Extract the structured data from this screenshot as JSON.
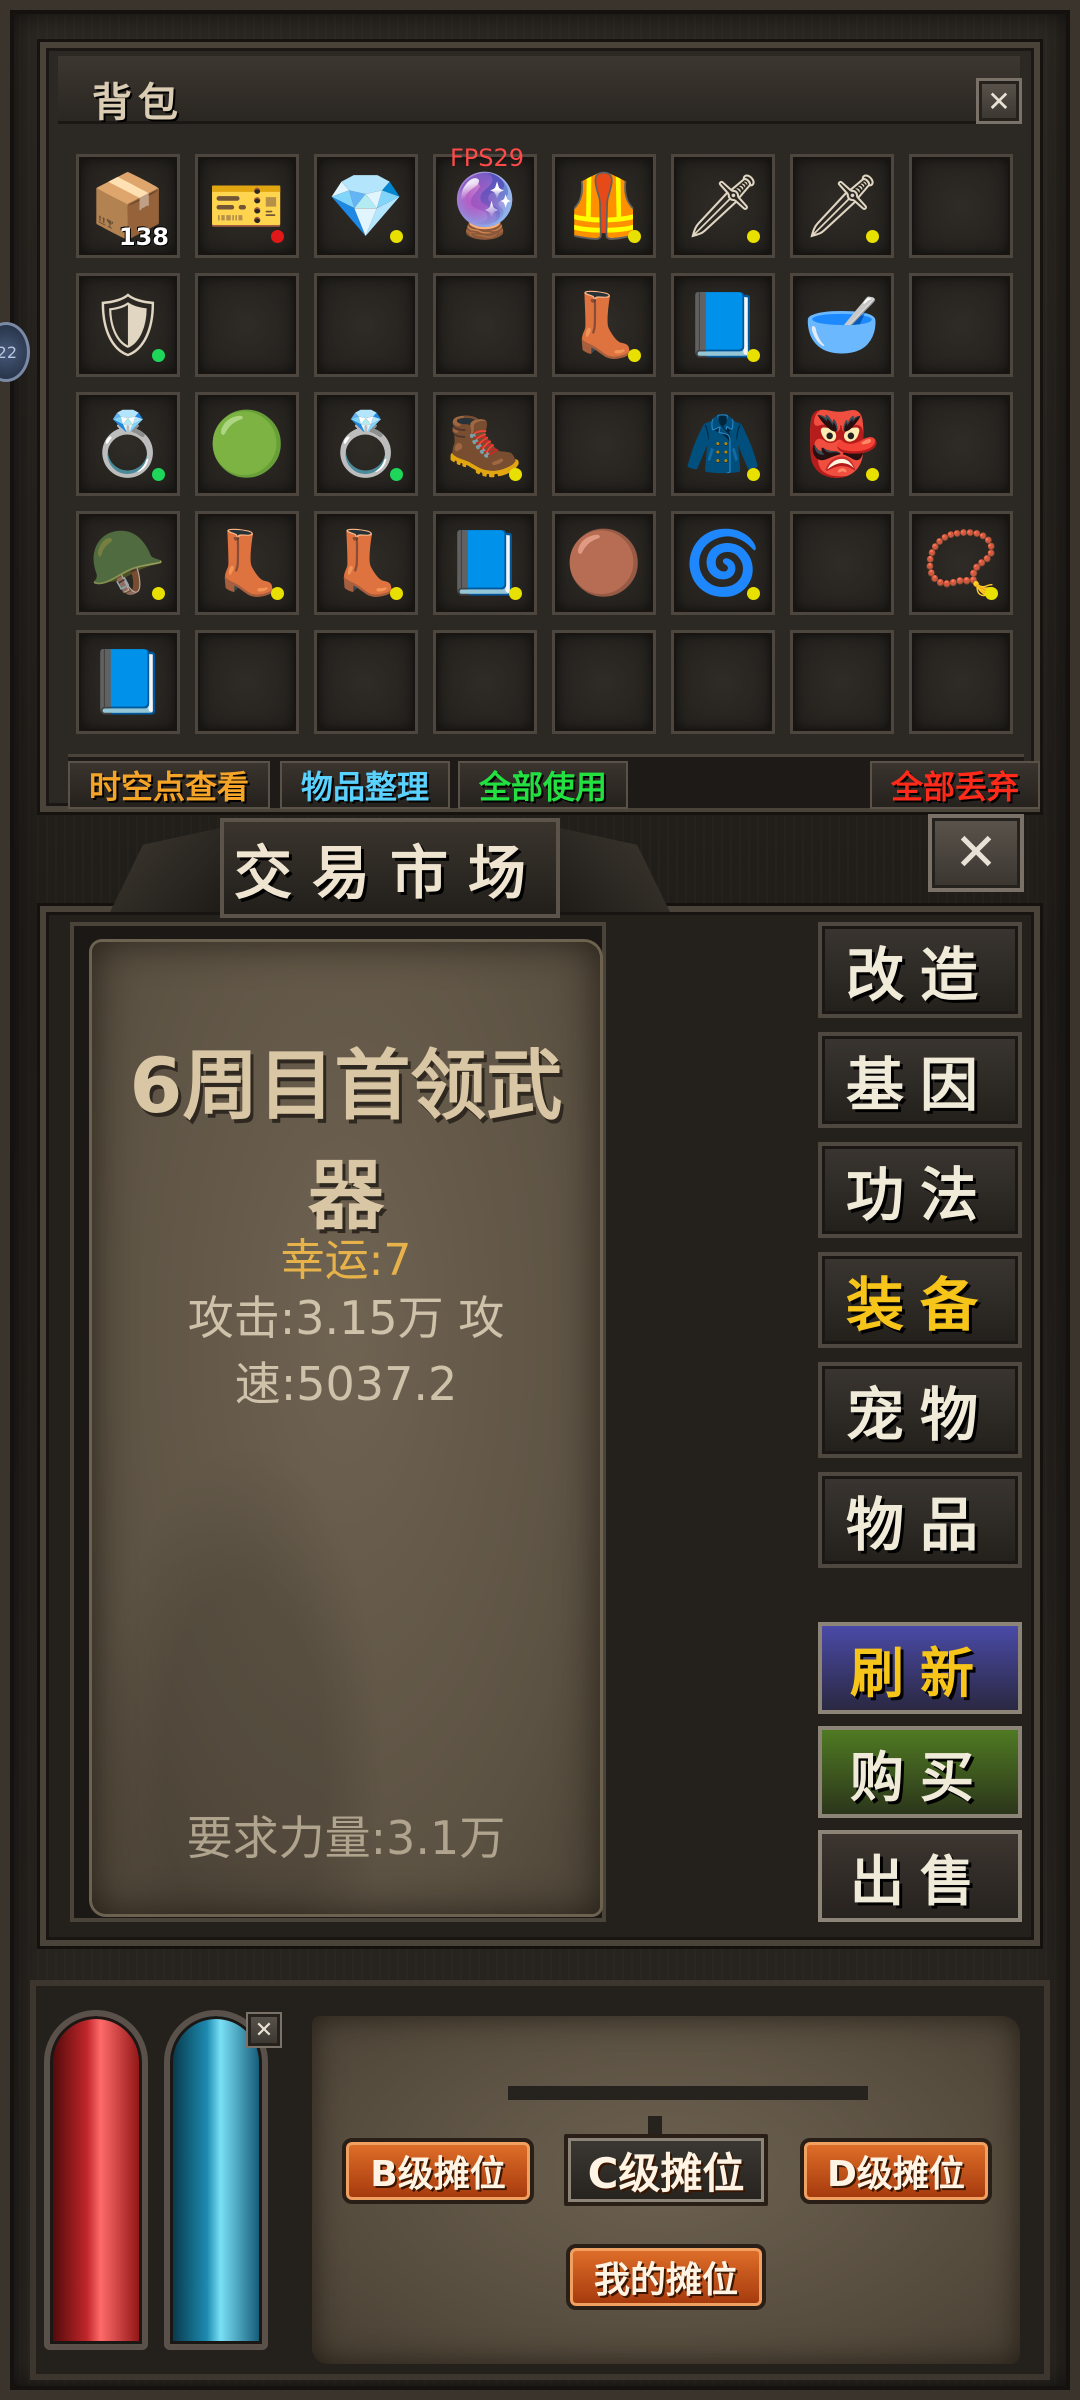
{
  "fps": "FPS29",
  "edge_badge": "22",
  "bag": {
    "title": "背包",
    "close": "✕",
    "slots": [
      {
        "icon": "📦",
        "name": "item-bundle-icon",
        "dot": "",
        "count": "138"
      },
      {
        "icon": "🎫",
        "name": "purple-scroll-icon",
        "dot": "red"
      },
      {
        "icon": "💎",
        "name": "blue-crystal-icon",
        "dot": "yellow"
      },
      {
        "icon": "🔮",
        "name": "green-orb-icon",
        "dot": ""
      },
      {
        "icon": "🦺",
        "name": "white-armor-icon",
        "dot": "yellow"
      },
      {
        "icon": "🗡",
        "name": "claw-weapon-icon",
        "dot": "yellow"
      },
      {
        "icon": "🗡",
        "name": "claw-weapon-icon",
        "dot": "yellow"
      },
      {
        "icon": "",
        "name": "empty-slot",
        "dot": ""
      },
      {
        "icon": "🛡",
        "name": "dark-helmet-icon",
        "dot": "green"
      },
      {
        "icon": "",
        "name": "empty-slot",
        "dot": ""
      },
      {
        "icon": "",
        "name": "empty-slot",
        "dot": ""
      },
      {
        "icon": "",
        "name": "empty-slot",
        "dot": ""
      },
      {
        "icon": "👢",
        "name": "red-boots-icon",
        "dot": "yellow"
      },
      {
        "icon": "📘",
        "name": "skill-book-icon",
        "dot": "yellow"
      },
      {
        "icon": "🥣",
        "name": "potion-bowl-icon",
        "dot": ""
      },
      {
        "icon": "",
        "name": "empty-slot",
        "dot": ""
      },
      {
        "icon": "💍",
        "name": "dark-ring-icon",
        "dot": "green"
      },
      {
        "icon": "🟢",
        "name": "jade-stone-icon",
        "dot": ""
      },
      {
        "icon": "💍",
        "name": "gold-ring-icon",
        "dot": "green"
      },
      {
        "icon": "🥾",
        "name": "gold-greaves-icon",
        "dot": "yellow"
      },
      {
        "icon": "",
        "name": "empty-slot",
        "dot": ""
      },
      {
        "icon": "🧥",
        "name": "red-armor-icon",
        "dot": "yellow"
      },
      {
        "icon": "👺",
        "name": "green-mask-icon",
        "dot": "yellow"
      },
      {
        "icon": "",
        "name": "empty-slot",
        "dot": ""
      },
      {
        "icon": "🪖",
        "name": "gold-helmet-icon",
        "dot": "yellow"
      },
      {
        "icon": "👢",
        "name": "blue-boots-icon",
        "dot": "yellow"
      },
      {
        "icon": "👢",
        "name": "blue-boots-icon",
        "dot": "yellow"
      },
      {
        "icon": "📘",
        "name": "skill-book-icon",
        "dot": "yellow"
      },
      {
        "icon": "🟤",
        "name": "fur-ball-icon",
        "dot": ""
      },
      {
        "icon": "🌀",
        "name": "purple-bracelet-icon",
        "dot": "yellow"
      },
      {
        "icon": "",
        "name": "empty-slot",
        "dot": ""
      },
      {
        "icon": "📿",
        "name": "gold-necklace-icon",
        "dot": "yellow"
      },
      {
        "icon": "📘",
        "name": "skill-book-icon",
        "dot": ""
      },
      {
        "icon": "",
        "name": "empty-slot",
        "dot": ""
      },
      {
        "icon": "",
        "name": "empty-slot",
        "dot": ""
      },
      {
        "icon": "",
        "name": "empty-slot",
        "dot": ""
      },
      {
        "icon": "",
        "name": "empty-slot",
        "dot": ""
      },
      {
        "icon": "",
        "name": "empty-slot",
        "dot": ""
      },
      {
        "icon": "",
        "name": "empty-slot",
        "dot": ""
      },
      {
        "icon": "",
        "name": "empty-slot",
        "dot": ""
      }
    ],
    "actions": {
      "view_points": {
        "label": "时空点查看",
        "color": "#f5a428"
      },
      "sort": {
        "label": "物品整理",
        "color": "#5ad2ff"
      },
      "use_all": {
        "label": "全部使用",
        "color": "#22e040"
      },
      "discard_all": {
        "label": "全部丢弃",
        "color": "#ff2a1a"
      }
    }
  },
  "market": {
    "title": "交易市场",
    "close": "✕",
    "item": {
      "name": "6周目首领武器",
      "luck": "幸运:7",
      "attack": "攻击:3.15万 攻速:5037.2",
      "requirement": "要求力量:3.1万"
    },
    "tabs": [
      {
        "label": "改造",
        "active": false
      },
      {
        "label": "基因",
        "active": false
      },
      {
        "label": "功法",
        "active": false
      },
      {
        "label": "装备",
        "active": true
      },
      {
        "label": "宠物",
        "active": false
      },
      {
        "label": "物品",
        "active": false
      }
    ],
    "actions": {
      "refresh": {
        "label": "刷新",
        "color": "#f7c51a",
        "bg": "#4a4aa8"
      },
      "buy": {
        "label": "购买",
        "color": "#f0ead8",
        "bg": "#4f7a22"
      },
      "sell": {
        "label": "出售",
        "color": "#f0ead8",
        "bg": "#3c3530"
      }
    }
  },
  "stalls": {
    "close": "✕",
    "b_grade": "B级摊位",
    "c_grade": "C级摊位",
    "d_grade": "D级摊位",
    "mine": "我的摊位"
  }
}
